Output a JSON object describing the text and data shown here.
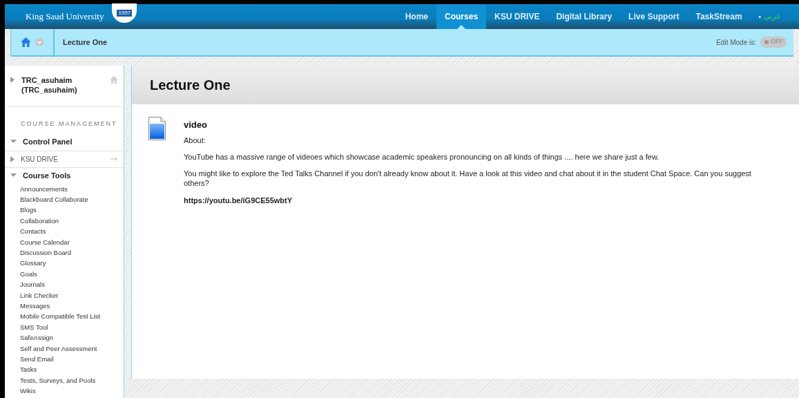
{
  "brand": {
    "name": "King Saud University",
    "badge": "1957"
  },
  "nav": [
    {
      "label": "Home",
      "selected": false
    },
    {
      "label": "Courses",
      "selected": true
    },
    {
      "label": "KSU DRIVE",
      "selected": false
    },
    {
      "label": "Digital Library",
      "selected": false
    },
    {
      "label": "Live Support",
      "selected": false
    },
    {
      "label": "TaskStream",
      "selected": false
    }
  ],
  "language": {
    "bullet": "•",
    "label": "عربي"
  },
  "breadcrumb": {
    "current": "Lecture One"
  },
  "edit_mode": {
    "label": "Edit Mode is:",
    "toggle": "OFF",
    "on": false
  },
  "sidebar": {
    "course": {
      "name": "TRC_asuhaim (TRC_asuhaim)",
      "expanded": false
    },
    "heading": "COURSE MANAGEMENT",
    "sections": [
      {
        "label": "Control Panel",
        "expanded": true,
        "kind": "group"
      },
      {
        "label": "KSU DRIVE",
        "expanded": false,
        "kind": "link"
      },
      {
        "label": "Course Tools",
        "expanded": true,
        "kind": "group",
        "children": [
          {
            "label": "Announcements"
          },
          {
            "label": "Blackboard Collaborate"
          },
          {
            "label": "Blogs"
          },
          {
            "label": "Collaboration"
          },
          {
            "label": "Contacts"
          },
          {
            "label": "Course Calendar"
          },
          {
            "label": "Discussion Board"
          },
          {
            "label": "Glossary"
          },
          {
            "label": "Goals"
          },
          {
            "label": "Journals"
          },
          {
            "label": "Link Checker"
          },
          {
            "label": "Messages"
          },
          {
            "label": "Mobile Compatible Test List"
          },
          {
            "label": "SMS Tool"
          },
          {
            "label": "SafeAssign"
          },
          {
            "label": "Self and Peer Assessment"
          },
          {
            "label": "Send Email"
          },
          {
            "label": "Tasks"
          },
          {
            "label": "Tests, Surveys, and Pools"
          },
          {
            "label": "Wikis"
          }
        ]
      }
    ]
  },
  "content": {
    "title": "Lecture One",
    "items": [
      {
        "title": "video",
        "paragraphs": [
          "About:",
          "YouTube has a massive range of videoes which showcase academic speakers pronouncing on all kinds of things .... here we share just a few.",
          "You might like to explore the Ted Talks Channel if you don't already know about it. Have a look at this video and chat about it in the student Chat Space. Can you suggest others?"
        ],
        "link": "https://youtu.be/iG9CE55wbtY"
      }
    ]
  }
}
